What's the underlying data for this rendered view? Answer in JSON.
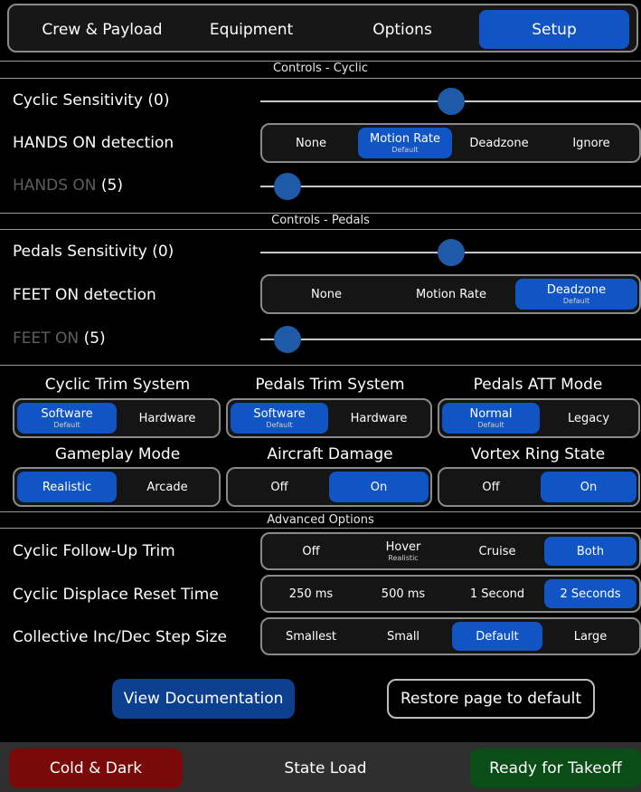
{
  "tabs": [
    "Crew & Payload",
    "Equipment",
    "Options",
    "Setup"
  ],
  "active_tab": "Setup",
  "colors": {
    "accent": "#1155c4",
    "knob": "#1f5aa8",
    "danger": "#7a0a0a",
    "success": "#0b4d16"
  },
  "cyclic": {
    "section_title": "Controls - Cyclic",
    "sensitivity_label": "Cyclic Sensitivity (0)",
    "sensitivity_level": 0.5,
    "detection_label": "HANDS ON detection",
    "detection_options": [
      {
        "label": "None",
        "sub": ""
      },
      {
        "label": "Motion Rate",
        "sub": "Default"
      },
      {
        "label": "Deadzone",
        "sub": ""
      },
      {
        "label": "Ignore",
        "sub": ""
      }
    ],
    "detection_selected": "Motion Rate",
    "hands_on_label": "HANDS ON",
    "hands_on_value": "(5)",
    "hands_on_level": 0.05
  },
  "pedals": {
    "section_title": "Controls - Pedals",
    "sensitivity_label": "Pedals Sensitivity (0)",
    "sensitivity_level": 0.5,
    "detection_label": "FEET ON detection",
    "detection_options": [
      {
        "label": "None",
        "sub": ""
      },
      {
        "label": "Motion Rate",
        "sub": ""
      },
      {
        "label": "Deadzone",
        "sub": "Default"
      }
    ],
    "detection_selected": "Deadzone",
    "feet_on_label": "FEET ON",
    "feet_on_value": "(5)",
    "feet_on_level": 0.05
  },
  "systems": {
    "cyclic_trim": {
      "title": "Cyclic Trim System",
      "options": [
        {
          "label": "Software",
          "sub": "Default"
        },
        {
          "label": "Hardware",
          "sub": ""
        }
      ],
      "selected": "Software"
    },
    "pedals_trim": {
      "title": "Pedals Trim System",
      "options": [
        {
          "label": "Software",
          "sub": "Default"
        },
        {
          "label": "Hardware",
          "sub": ""
        }
      ],
      "selected": "Software"
    },
    "pedals_att": {
      "title": "Pedals ATT Mode",
      "options": [
        {
          "label": "Normal",
          "sub": "Default"
        },
        {
          "label": "Legacy",
          "sub": ""
        }
      ],
      "selected": "Normal"
    },
    "gameplay": {
      "title": "Gameplay Mode",
      "options": [
        {
          "label": "Realistic",
          "sub": ""
        },
        {
          "label": "Arcade",
          "sub": ""
        }
      ],
      "selected": "Realistic"
    },
    "damage": {
      "title": "Aircraft Damage",
      "options": [
        {
          "label": "Off",
          "sub": ""
        },
        {
          "label": "On",
          "sub": ""
        }
      ],
      "selected": "On"
    },
    "vortex": {
      "title": "Vortex Ring State",
      "options": [
        {
          "label": "Off",
          "sub": ""
        },
        {
          "label": "On",
          "sub": ""
        }
      ],
      "selected": "On"
    }
  },
  "advanced": {
    "section_title": "Advanced Options",
    "follow_up": {
      "label": "Cyclic Follow-Up Trim",
      "options": [
        {
          "label": "Off",
          "sub": ""
        },
        {
          "label": "Hover",
          "sub": "Realistic"
        },
        {
          "label": "Cruise",
          "sub": ""
        },
        {
          "label": "Both",
          "sub": ""
        }
      ],
      "selected": "Both"
    },
    "displace": {
      "label": "Cyclic Displace Reset Time",
      "options": [
        {
          "label": "250 ms",
          "sub": ""
        },
        {
          "label": "500 ms",
          "sub": ""
        },
        {
          "label": "1 Second",
          "sub": ""
        },
        {
          "label": "2 Seconds",
          "sub": ""
        }
      ],
      "selected": "2 Seconds"
    },
    "step": {
      "label": "Collective Inc/Dec Step Size",
      "options": [
        {
          "label": "Smallest",
          "sub": ""
        },
        {
          "label": "Small",
          "sub": ""
        },
        {
          "label": "Default",
          "sub": ""
        },
        {
          "label": "Large",
          "sub": ""
        }
      ],
      "selected": "Default"
    }
  },
  "buttons": {
    "view_docs": "View Documentation",
    "restore": "Restore page to default"
  },
  "bottom": {
    "cold_dark": "Cold & Dark",
    "state_load": "State Load",
    "ready": "Ready for Takeoff"
  }
}
